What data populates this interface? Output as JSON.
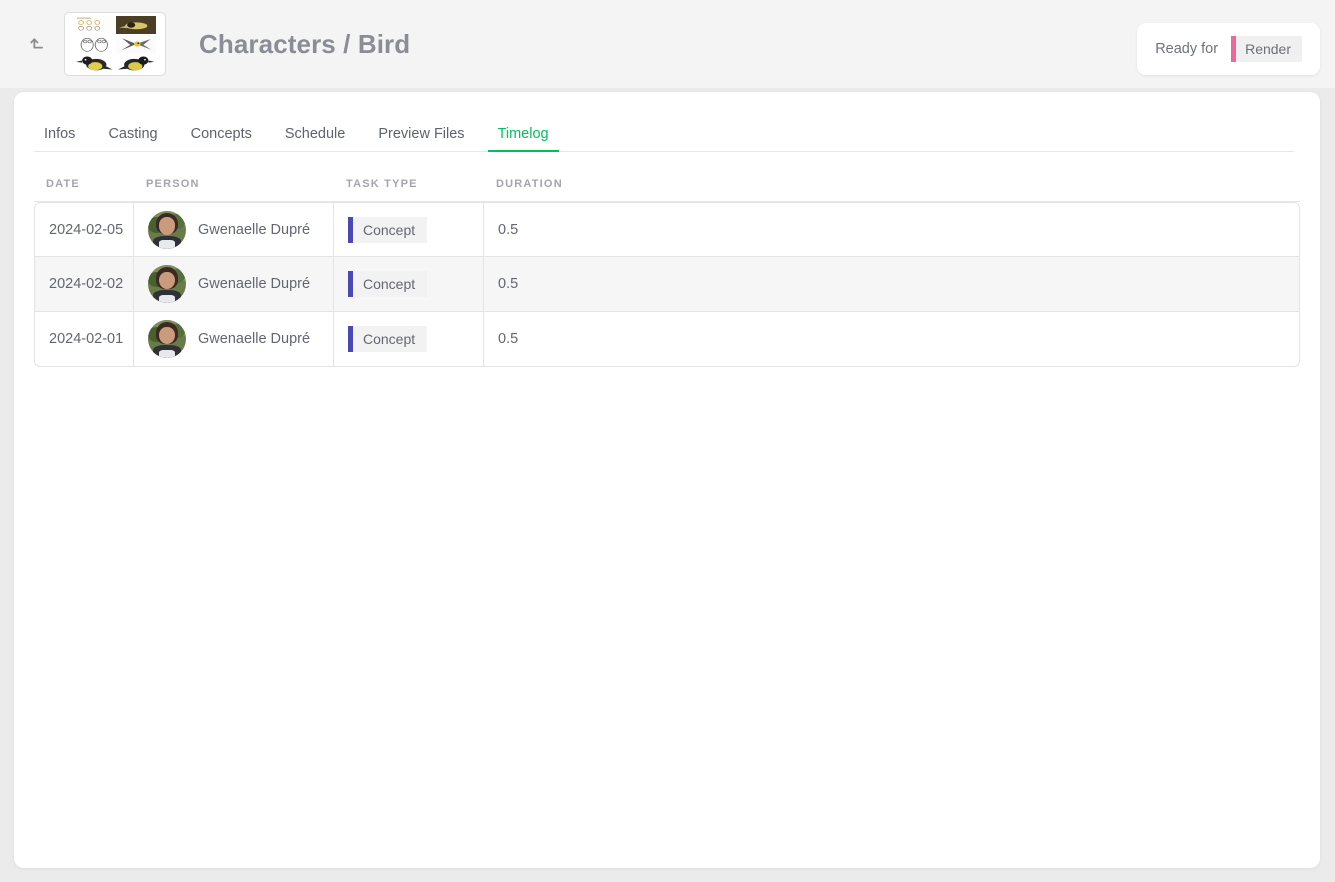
{
  "header": {
    "back_icon": "return-arrow-icon",
    "thumbnail_alt": "bird-concept-thumbnail",
    "title": "Characters / Bird",
    "status": {
      "label": "Ready for",
      "chip": "Render",
      "chip_accent": "#e8699a"
    }
  },
  "tabs": [
    {
      "label": "Infos",
      "active": false
    },
    {
      "label": "Casting",
      "active": false
    },
    {
      "label": "Concepts",
      "active": false
    },
    {
      "label": "Schedule",
      "active": false
    },
    {
      "label": "Preview Files",
      "active": false
    },
    {
      "label": "Timelog",
      "active": true
    }
  ],
  "table": {
    "columns": [
      "DATE",
      "PERSON",
      "TASK TYPE",
      "DURATION"
    ],
    "rows": [
      {
        "date": "2024-02-05",
        "person": "Gwenaelle Dupré",
        "task_type": "Concept",
        "task_color": "#4a4ab5",
        "duration": "0.5"
      },
      {
        "date": "2024-02-02",
        "person": "Gwenaelle Dupré",
        "task_type": "Concept",
        "task_color": "#4a4ab5",
        "duration": "0.5"
      },
      {
        "date": "2024-02-01",
        "person": "Gwenaelle Dupré",
        "task_type": "Concept",
        "task_color": "#4a4ab5",
        "duration": "0.5"
      }
    ]
  },
  "theme": {
    "accent_green": "#00bf60",
    "page_bg": "#ebebeb",
    "header_bg": "#f4f4f4",
    "card_bg": "#ffffff"
  }
}
